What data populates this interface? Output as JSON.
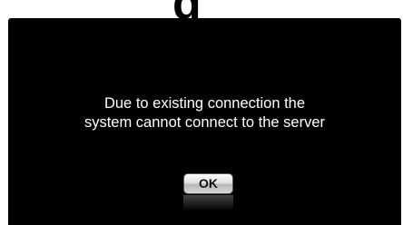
{
  "header": {
    "title_fragment": "g"
  },
  "dialog": {
    "message_lines": [
      "Due to existing connection the",
      "system cannot connect to the server"
    ],
    "ok_label": "OK"
  },
  "colors": {
    "dialog_background": "#000000",
    "page_background": "#ffffff",
    "message_text": "#ffffff"
  }
}
